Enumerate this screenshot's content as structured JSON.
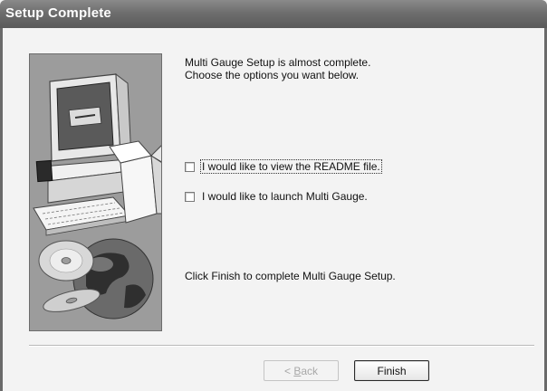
{
  "window": {
    "title": "Setup Complete"
  },
  "content": {
    "intro_line1": "Multi Gauge Setup is almost complete.",
    "intro_line2": "Choose the options you want below.",
    "finish_text": "Click Finish to complete Multi Gauge Setup."
  },
  "options": [
    {
      "label": "I would like to view the README file.",
      "checked": false
    },
    {
      "label": "I would like to launch Multi Gauge.",
      "checked": false
    }
  ],
  "buttons": {
    "back_prefix": "< ",
    "back_hotkey": "B",
    "back_rest": "ack",
    "finish": "Finish",
    "back_enabled": false
  },
  "banner": {
    "icons": [
      "computer-icon",
      "open-box-icon",
      "cd-discs-icon",
      "globe-icon"
    ]
  }
}
